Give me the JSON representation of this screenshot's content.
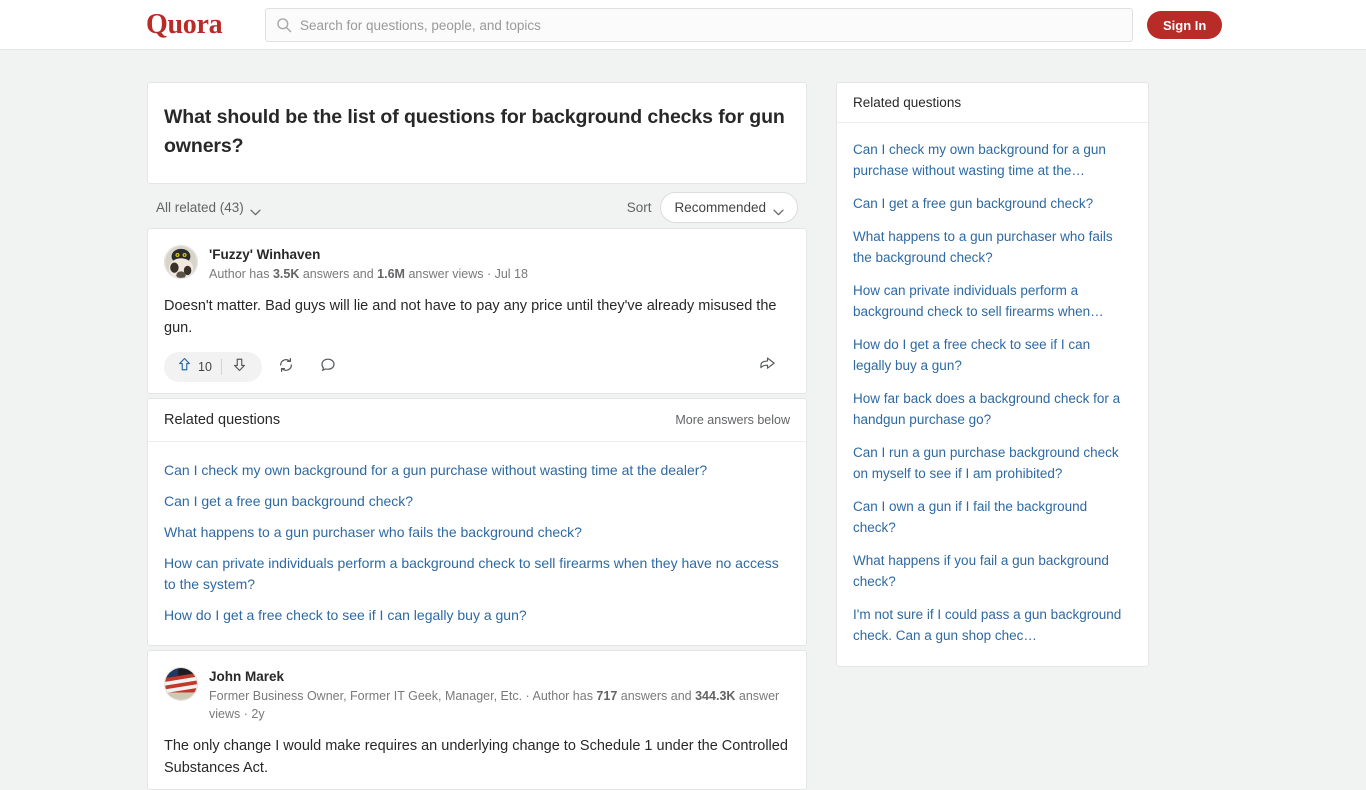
{
  "header": {
    "logo": "Quora",
    "search_placeholder": "Search for questions, people, and topics",
    "search_value": "",
    "signin_label": "Sign In",
    "brand_color": "#b92b27"
  },
  "question": {
    "title": "What should be the list of questions for background checks for gun owners?"
  },
  "filters": {
    "all_related_label": "All related (43)",
    "sort_label": "Sort",
    "sort_value": "Recommended"
  },
  "answers": [
    {
      "author_name": "'Fuzzy' Winhaven",
      "credential_prefix": "Author has ",
      "answers_count": "3.5K",
      "credential_mid": " answers and ",
      "views_count": "1.6M",
      "credential_suffix": " answer views · Jul 18",
      "body": "Doesn't matter. Bad guys will lie and not have to pay any price until they've already misused the gun.",
      "upvote_count": "10",
      "avatar_kind": "cat-photo"
    },
    {
      "author_name": "John Marek",
      "credential_prefix": "Former Business Owner, Former IT Geek, Manager, Etc. · Author has ",
      "answers_count": "717",
      "credential_mid": " answers and ",
      "views_count": "344.3K",
      "credential_suffix": " answer views · 2y",
      "body": "The only change I would make requires an underlying change to Schedule 1 under the Controlled Substances Act.",
      "avatar_kind": "flag-photo"
    }
  ],
  "related_main": {
    "title": "Related questions",
    "more_label": "More answers below",
    "items": [
      "Can I check my own background for a gun purchase without wasting time at the dealer?",
      "Can I get a free gun background check?",
      "What happens to a gun purchaser who fails the background check?",
      "How can private individuals perform a background check to sell firearms when they have no access to the system?",
      "How do I get a free check to see if I can legally buy a gun?"
    ]
  },
  "sidebar": {
    "title": "Related questions",
    "items": [
      "Can I check my own background for a gun purchase without wasting time at the…",
      "Can I get a free gun background check?",
      "What happens to a gun purchaser who fails the background check?",
      "How can private individuals perform a background check to sell firearms when…",
      "How do I get a free check to see if I can legally buy a gun?",
      "How far back does a background check for a handgun purchase go?",
      "Can I run a gun purchase background check on myself to see if I am prohibited?",
      "Can I own a gun if I fail the background check?",
      "What happens if you fail a gun background check?",
      "I'm not sure if I could pass a gun background check. Can a gun shop chec…"
    ]
  },
  "icons": {
    "search": "search-icon",
    "upvote": "upvote-arrow-icon",
    "downvote": "downvote-arrow-icon",
    "repost": "repost-icon",
    "comment": "comment-bubble-icon",
    "share": "share-arrow-icon",
    "chevron": "chevron-down-icon"
  }
}
